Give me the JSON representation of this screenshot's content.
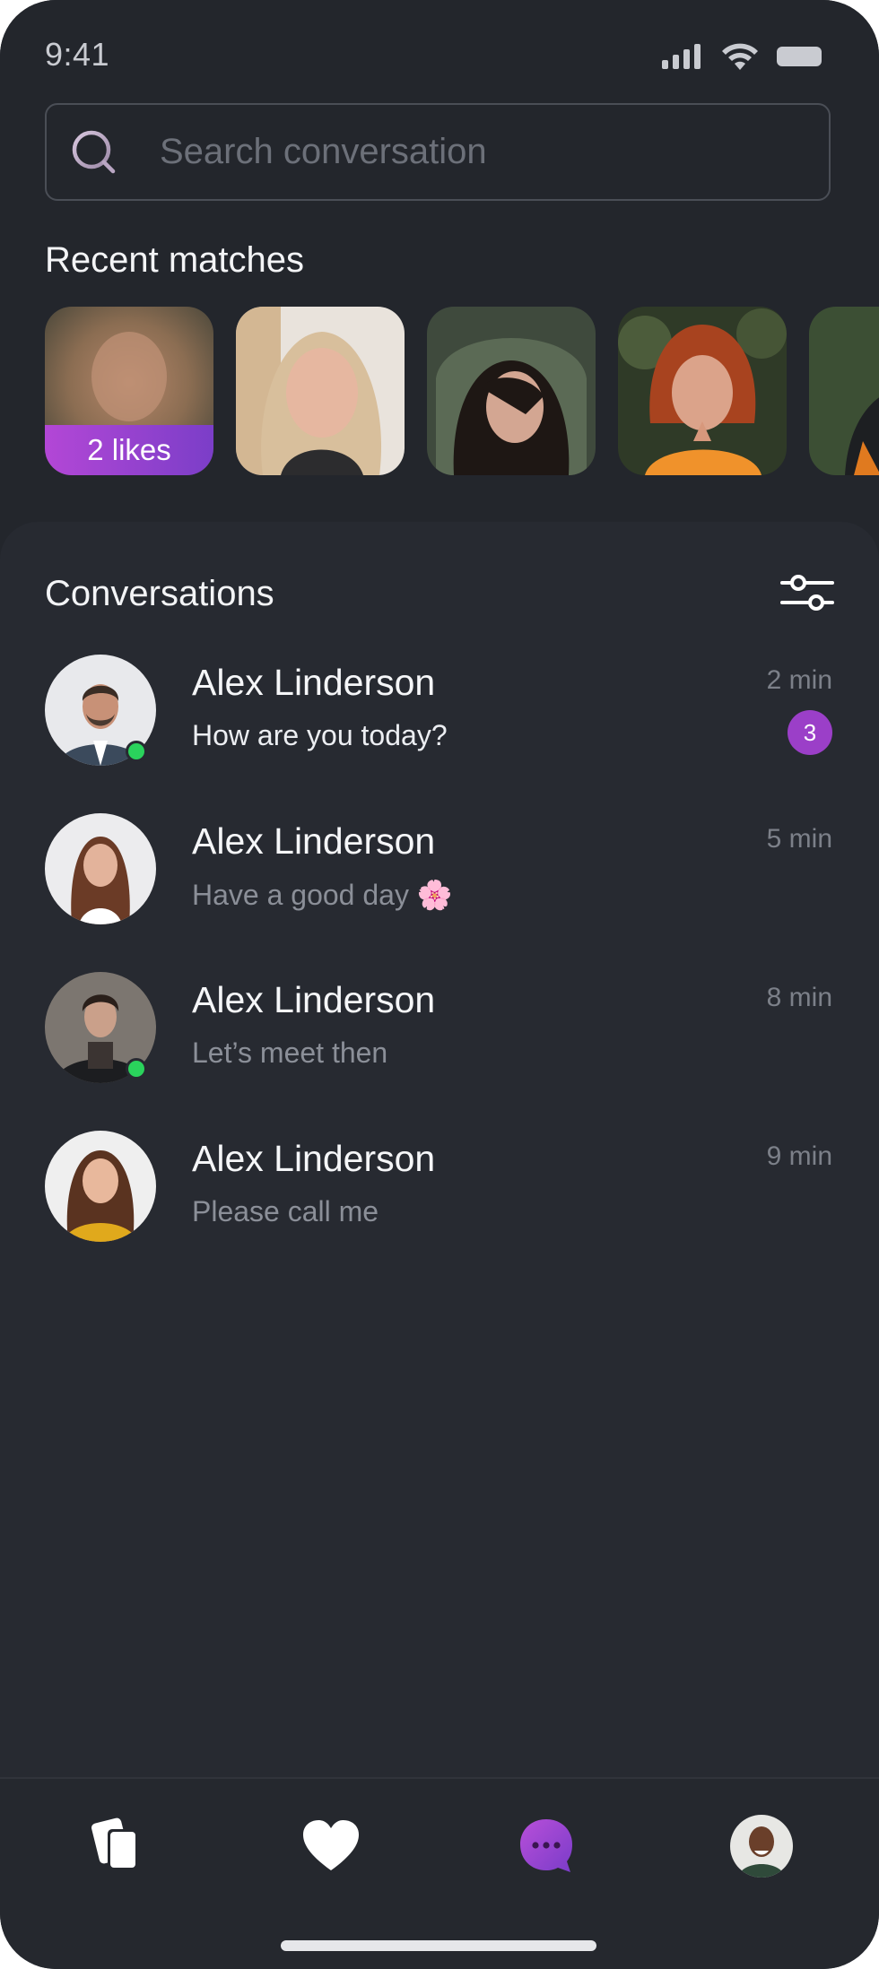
{
  "status_bar": {
    "time": "9:41"
  },
  "search": {
    "placeholder": "Search conversation"
  },
  "recent_matches": {
    "title": "Recent matches",
    "likes_label": "2 likes"
  },
  "conversations": {
    "title": "Conversations",
    "items": [
      {
        "name": "Alex Linderson",
        "message": "How are you today?",
        "time": "2 min",
        "unread": "3",
        "online": true
      },
      {
        "name": "Alex Linderson",
        "message": "Have a good day 🌸",
        "time": "5 min",
        "online": false
      },
      {
        "name": "Alex Linderson",
        "message": "Let’s meet then",
        "time": "8 min",
        "online": true
      },
      {
        "name": "Alex Linderson",
        "message": "Please call me",
        "time": "9 min",
        "online": false
      }
    ]
  },
  "tabbar": {
    "tabs": [
      "cards-icon",
      "heart-icon",
      "chat-icon",
      "profile-avatar"
    ],
    "active": "chat-icon"
  },
  "colors": {
    "background": "#23262c",
    "panel": "#272a31",
    "accent": "#9b3fc8",
    "online": "#2ad35c"
  }
}
